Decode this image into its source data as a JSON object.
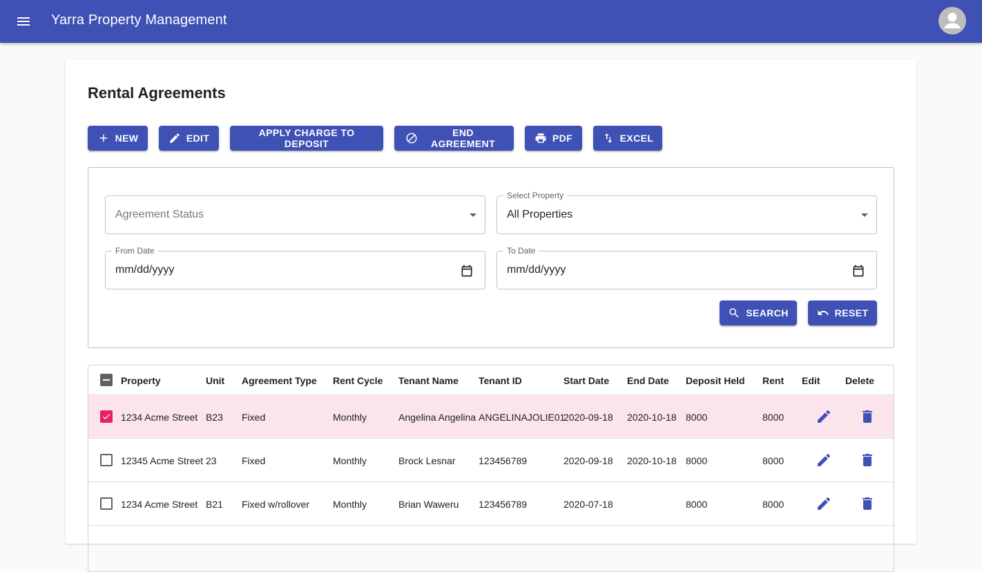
{
  "app": {
    "title": "Yarra Property Management"
  },
  "page": {
    "title": "Rental Agreements"
  },
  "toolbar": {
    "new_label": "NEW",
    "edit_label": "EDIT",
    "apply_charge_label": "APPLY CHARGE TO DEPOSIT",
    "end_agreement_label": "END AGREEMENT",
    "pdf_label": "PDF",
    "excel_label": "EXCEL"
  },
  "filters": {
    "agreement_status_placeholder": "Agreement Status",
    "property_label": "Select Property",
    "property_value": "All Properties",
    "from_date_label": "From Date",
    "from_date_value": "mm/dd/yyyy",
    "to_date_label": "To Date",
    "to_date_value": "mm/dd/yyyy",
    "search_label": "SEARCH",
    "reset_label": "RESET"
  },
  "table": {
    "headers": {
      "property": "Property",
      "unit": "Unit",
      "agreement_type": "Agreement Type",
      "rent_cycle": "Rent Cycle",
      "tenant_name": "Tenant Name",
      "tenant_id": "Tenant ID",
      "start_date": "Start Date",
      "end_date": "End Date",
      "deposit_held": "Deposit Held",
      "rent": "Rent",
      "edit": "Edit",
      "delete": "Delete"
    },
    "rows": [
      {
        "property": "1234 Acme Street",
        "unit": "B23",
        "agreement_type": "Fixed",
        "rent_cycle": "Monthly",
        "tenant_name": "Angelina Angelina",
        "tenant_id": "ANGELINAJOLIE01",
        "start_date": "2020-09-18",
        "end_date": "2020-10-18",
        "deposit_held": "8000",
        "rent": "8000",
        "selected": true
      },
      {
        "property": "12345 Acme Street",
        "unit": "23",
        "agreement_type": "Fixed",
        "rent_cycle": "Monthly",
        "tenant_name": "Brock Lesnar",
        "tenant_id": "123456789",
        "start_date": "2020-09-18",
        "end_date": "2020-10-18",
        "deposit_held": "8000",
        "rent": "8000",
        "selected": false
      },
      {
        "property": "1234 Acme Street",
        "unit": "B21",
        "agreement_type": "Fixed w/rollover",
        "rent_cycle": "Monthly",
        "tenant_name": "Brian Waweru",
        "tenant_id": "123456789",
        "start_date": "2020-07-18",
        "end_date": "",
        "deposit_held": "8000",
        "rent": "8000",
        "selected": false
      }
    ]
  },
  "colors": {
    "primary": "#3f51b5",
    "secondary": "#e91e63",
    "selected_row": "#fce4ec"
  }
}
